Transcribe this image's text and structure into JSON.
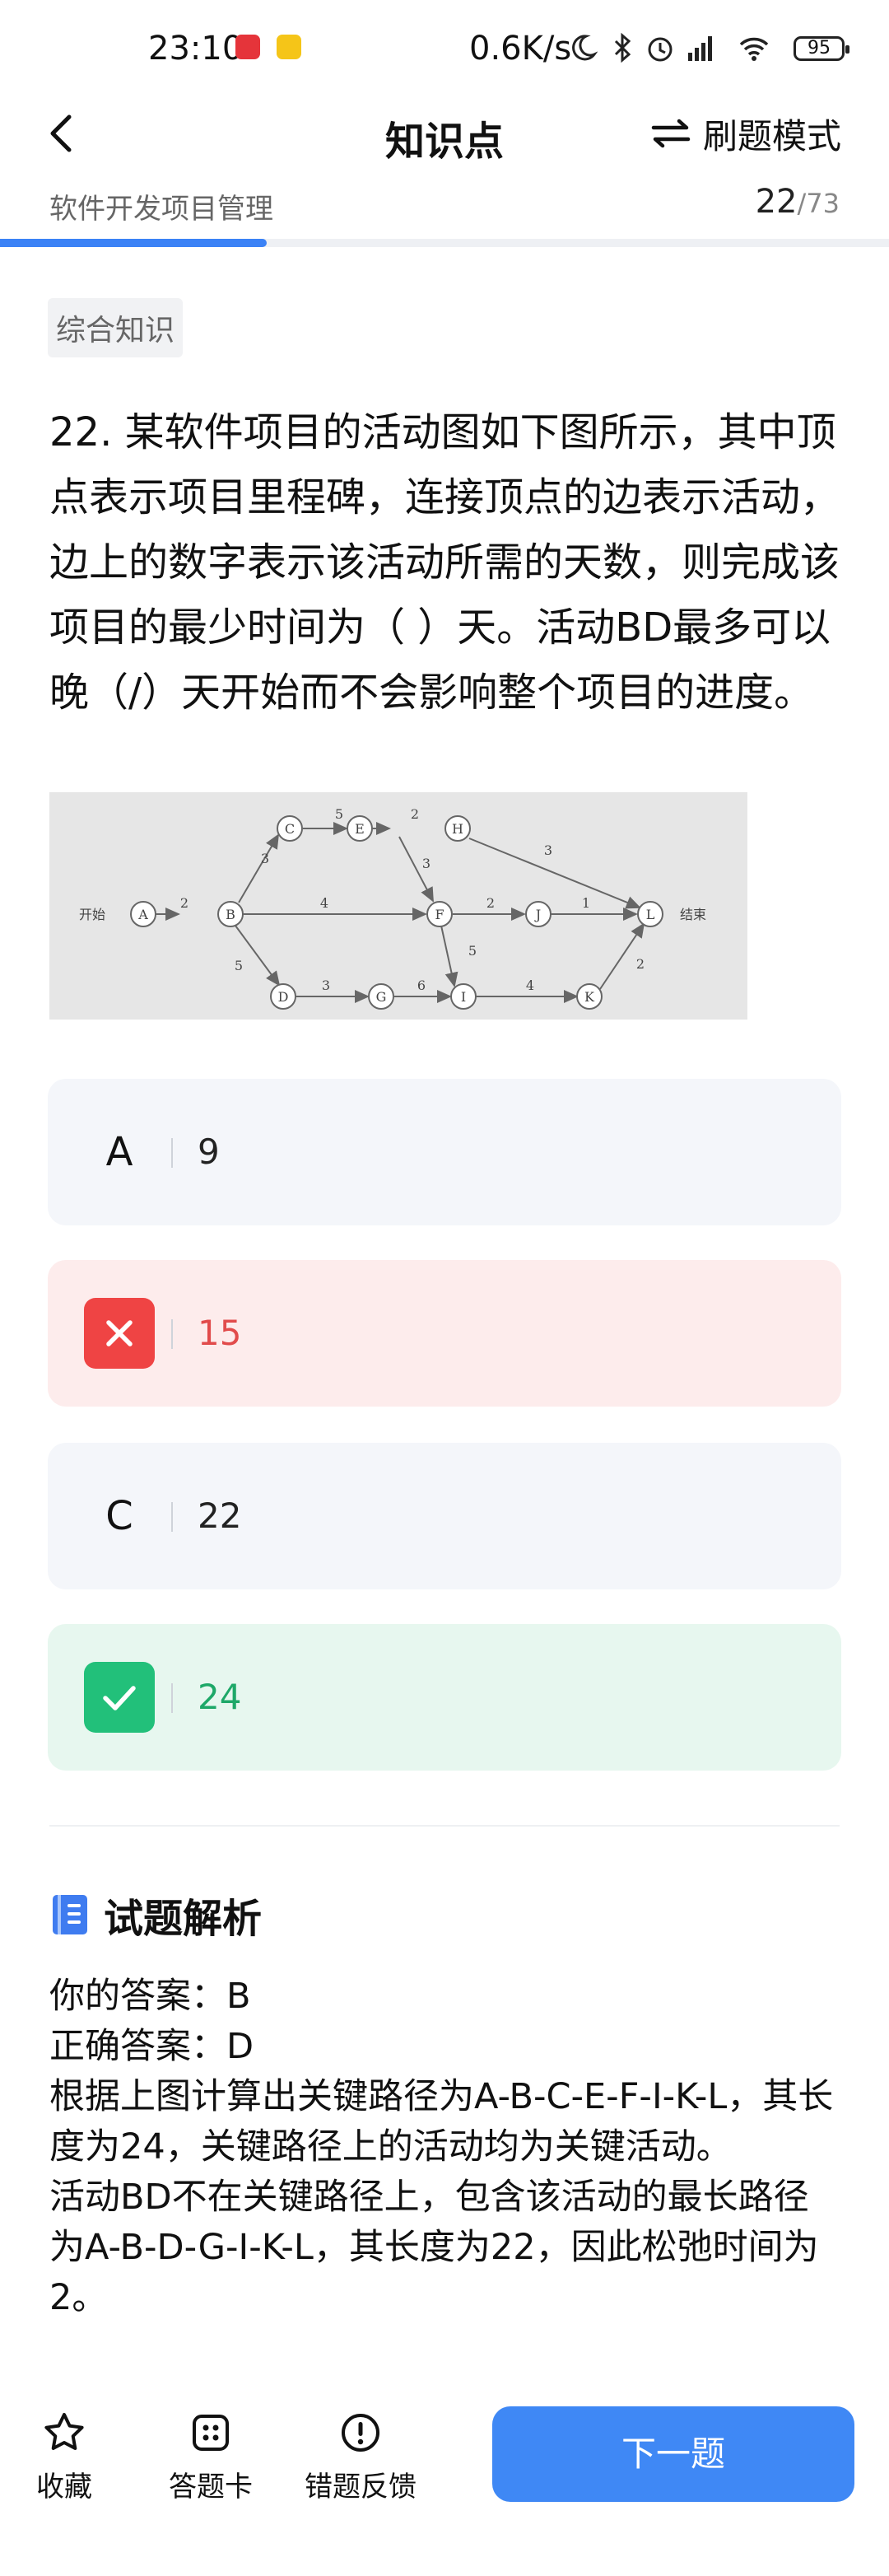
{
  "status_bar": {
    "time": "23:10",
    "net_speed": "0.6K/s",
    "battery": "95"
  },
  "header": {
    "title": "知识点",
    "mode_label": "刷题模式"
  },
  "subheader": {
    "subject": "软件开发项目管理",
    "current": "22",
    "total": "/73",
    "progress_fraction": 0.3
  },
  "tag": "综合知识",
  "question": {
    "text": "22. 某软件项目的活动图如下图所示，其中顶点表示项目里程碑，连接顶点的边表示活动，边上的数字表示该活动所需的天数，则完成该项目的最少时间为（ ）天。活动BD最多可以晚（/）天开始而不会影响整个项目的进度。"
  },
  "diagram": {
    "start_label": "开始",
    "end_label": "结束",
    "nodes": [
      "A",
      "B",
      "C",
      "E",
      "H",
      "F",
      "J",
      "L",
      "D",
      "G",
      "I",
      "K"
    ],
    "edge_weights": {
      "AB": "2",
      "BC": "3",
      "CE": "5",
      "EH": "2",
      "EF": "3",
      "HL": "3",
      "BF": "4",
      "FJ": "2",
      "JL": "1",
      "FI": "5",
      "BD": "5",
      "DG": "3",
      "GI": "6",
      "IK": "4",
      "KL": "2"
    }
  },
  "options": [
    {
      "key": "A",
      "value": "9",
      "state": "normal"
    },
    {
      "key": "B",
      "value": "15",
      "state": "wrong"
    },
    {
      "key": "C",
      "value": "22",
      "state": "normal"
    },
    {
      "key": "D",
      "value": "24",
      "state": "correct"
    }
  ],
  "analysis": {
    "title": "试题解析",
    "your_answer": "你的答案：B",
    "correct_answer": "正确答案：D",
    "explanation_1": "根据上图计算出关键路径为A-B-C-E-F-I-K-L，其长度为24，关键路径上的活动均为关键活动。",
    "explanation_2": "活动BD不在关键路径上，包含该活动的最长路径为A-B-D-G-I-K-L，其长度为22，因此松弛时间为2。"
  },
  "bottom_bar": {
    "favorite_label": "收藏",
    "answer_card_label": "答题卡",
    "feedback_label": "错题反馈",
    "next_label": "下一题"
  },
  "colors": {
    "accent": "#3f88f5",
    "wrong": "#ef4444",
    "correct": "#22c07a"
  }
}
